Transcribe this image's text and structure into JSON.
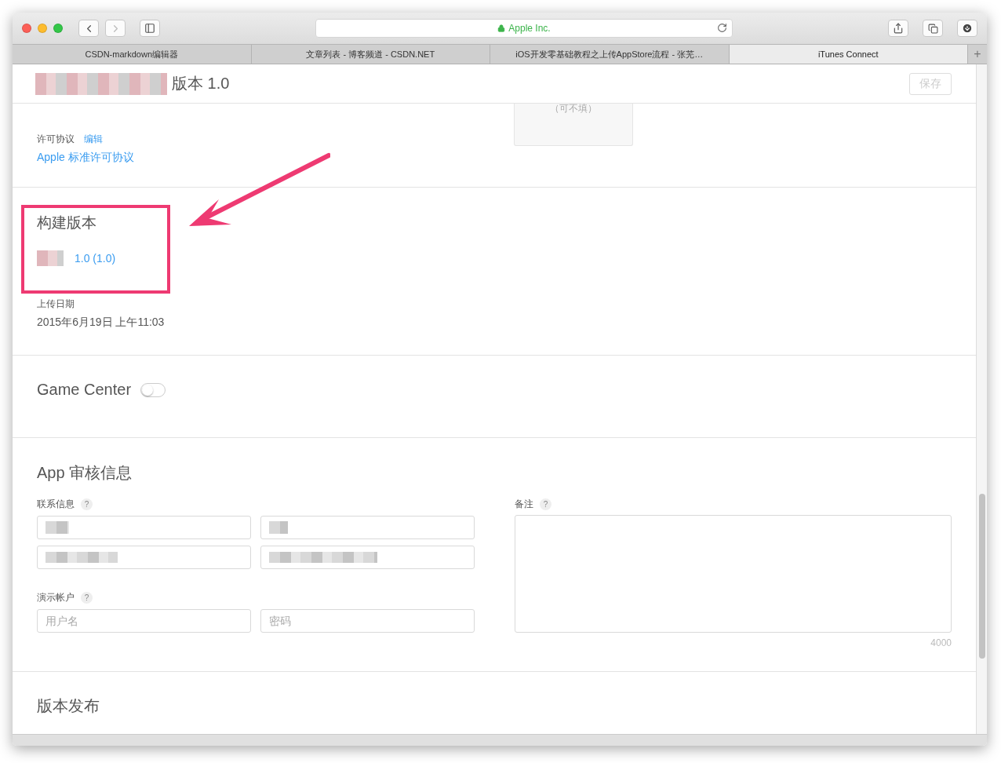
{
  "browser": {
    "address": "Apple Inc.",
    "tabs": [
      {
        "label": "CSDN-markdown编辑器",
        "selected": false
      },
      {
        "label": "文章列表 - 博客频道 - CSDN.NET",
        "selected": false
      },
      {
        "label": "iOS开发零基础教程之上传AppStore流程 - 张芜…",
        "selected": false
      },
      {
        "label": "iTunes Connect",
        "selected": true
      }
    ],
    "new_tab_button": "+"
  },
  "header": {
    "title": "版本 1.0",
    "save_button": {
      "label": "保存",
      "disabled": true
    }
  },
  "license": {
    "label": "许可协议",
    "edit_link": "编辑",
    "agreement_link": "Apple 标准许可协议",
    "optional_hint": "（可不填）"
  },
  "build": {
    "heading": "构建版本",
    "version_link": "1.0 (1.0)",
    "upload_label": "上传日期",
    "upload_date": "2015年6月19日 上午11:03"
  },
  "game_center": {
    "label": "Game Center",
    "on": false
  },
  "review": {
    "heading": "App 审核信息",
    "contact_label": "联系信息",
    "contact_help": "?",
    "demo_label": "演示帐户",
    "demo_help": "?",
    "username_placeholder": "用户名",
    "password_placeholder": "密码",
    "notes_label": "备注",
    "notes_help": "?",
    "notes_limit": "4000"
  },
  "release": {
    "heading": "版本发布"
  }
}
